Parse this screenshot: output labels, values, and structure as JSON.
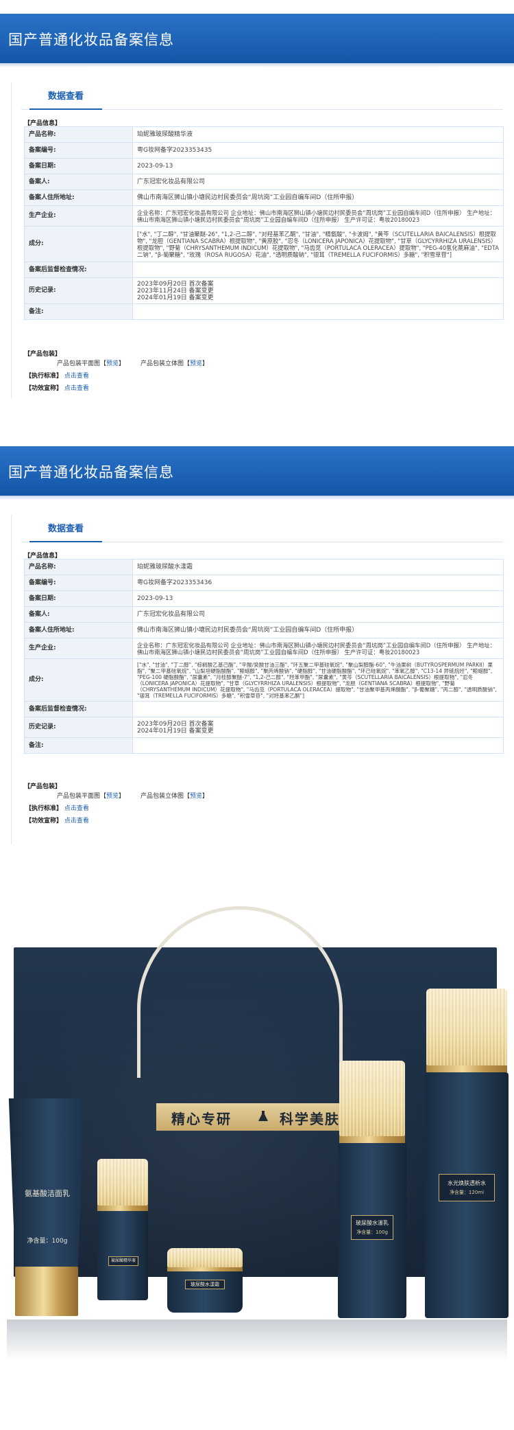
{
  "records": [
    {
      "header_title": "国产普通化妆品备案信息",
      "tab_label": "数据查看",
      "product_info_label": "【产品信息】",
      "fields": [
        {
          "key": "产品名称:",
          "value": "珀妮雅玻尿酸精华液"
        },
        {
          "key": "备案编号:",
          "value": "粤G妆网备字2023353435"
        },
        {
          "key": "备案日期:",
          "value": "2023-09-13"
        },
        {
          "key": "备案人:",
          "value": "广东冠宏化妆品有限公司"
        },
        {
          "key": "备案人住所地址:",
          "value": "佛山市南海区狮山镇小塘民边村民委员会“周坑岗”工业园自编车间D（住所申报）"
        },
        {
          "key": "生产企业:",
          "value": "企业名称：广东冠宏化妆品有限公司 企业地址：佛山市南海区狮山镇小塘民边村民委员会“周坑岗”工业园自编车间D（住所申报） 生产地址：佛山市南海区狮山镇小塘民边村民委员会“周坑岗”工业园自编车间D（住所申报） 生产许可证：粤妆20180023"
        },
        {
          "key": "成分:",
          "value": "[\"水\", \"丁二醇\", \"甘油聚醚-26\", \"1,2-己二醇\", \"对羟基苯乙酮\", \"甘油\", \"精氨酸\", \"卡波姆\", \"黄芩（SCUTELLARIA BAICALENSIS）根提取物\", \"龙胆（GENTIANA SCABRA）根提取物\", \"黄原胶\", \"忍冬（LONICERA JAPONICA）花提取物\", \"甘草（GLYCYRRHIZA URALENSIS）根提取物\", \"野菊（CHRYSANTHEMUM INDICUM）花提取物\", \"马齿苋（PORTULACA OLERACEA）提取物\", \"PEG-40氢化蓖麻油\", \"EDTA 二钠\", \"β-葡聚糖\", \"玫瑰（ROSA RUGOSA）花油\", \"透明质酸钠\", \"银耳（TREMELLA FUCIFORMIS）多糖\", \"积雪草苷\"]"
        },
        {
          "key": "备案后监督检查情况:",
          "value": ""
        },
        {
          "key": "历史记录:",
          "value_lines": [
            "2023年09月20日 首次备案",
            "2023年11月24日 备案变更",
            "2024年01月19日 备案变更"
          ]
        },
        {
          "key": "备注:",
          "value": ""
        }
      ],
      "packaging_label": "【产品包装】",
      "packaging_flat": "产品包装平面图",
      "packaging_3d": "产品包装立体图",
      "preview": "预览",
      "bracket_open": "【",
      "bracket_close": "】",
      "standard_label": "【执行标准】",
      "efficacy_label": "【功效宣称】",
      "click_view": "点击查看"
    },
    {
      "header_title": "国产普通化妆品备案信息",
      "tab_label": "数据查看",
      "product_info_label": "【产品信息】",
      "fields": [
        {
          "key": "产品名称:",
          "value": "珀妮雅玻尿酸水漾霜"
        },
        {
          "key": "备案编号:",
          "value": "粤G妆网备字2023353436"
        },
        {
          "key": "备案日期:",
          "value": "2023-09-13"
        },
        {
          "key": "备案人:",
          "value": "广东冠宏化妆品有限公司"
        },
        {
          "key": "备案人住所地址:",
          "value": "佛山市南海区狮山镇小塘民边村民委员会“周坑岗”工业园自编车间D（住所申报）"
        },
        {
          "key": "生产企业:",
          "value": "企业名称：广东冠宏化妆品有限公司 企业地址：佛山市南海区狮山镇小塘民边村民委员会“周坑岗”工业园自编车间D（住所申报） 生产地址：佛山市南海区狮山镇小塘民边村民委员会“周坑岗”工业园自编车间D（住所申报） 生产许可证：粤妆20180023"
        },
        {
          "key": "成分:",
          "value": "[\"水\", \"甘油\", \"丁二醇\", \"棕榈酸乙基己酯\", \"辛酸/癸酸甘油三酯\", \"环五聚二甲基硅氧烷\", \"聚山梨醇酯-60\", \"牛油果树（BUTYROSPERMUM PARKII）果脂\", \"聚二甲基硅氧烷\", \"山梨坦硬脂酸酯\", \"鲸蜡醇\", \"聚丙烯酸钠\", \"硬脂醇\", \"甘油硬脂酸酯\", \"环己硅氧烷\", \"苯氧乙醇\", \"C13-14 异链烷烃\", \"鲸蜡醇\", \"PEG-100 硬脂酸酯\", \"尿囊素\", \"月桂醇聚醚-7\", \"1,2-己二醇\", \"羟苯甲酯\", \"尿囊素\", \"黄芩（SCUTELLARIA BAICALENSIS）根提取物\", \"忍冬（LONICERA JAPONICA）花提取物\", \"甘草（GLYCYRRHIZA URALENSIS）根提取物\", \"龙胆（GENTIANA SCABRA）根提取物\", \"野菊（CHRYSANTHEMUM INDICUM）花提取物\", \"马齿苋（PORTULACA OLERACEA）提取物\", \"甘油聚甲基丙烯酸酯\", \"β-葡聚糖\", \"丙二醇\", \"透明质酸钠\", \"银耳（TREMELLA FUCIFORMIS）多糖\", \"积雪草苷\", \"对羟基苯乙酮\"]"
        },
        {
          "key": "备案后监督检查情况:",
          "value": ""
        },
        {
          "key": "历史记录:",
          "value_lines": [
            "2023年09月20日 首次备案",
            "2024年01月19日 备案变更"
          ]
        },
        {
          "key": "备注:",
          "value": ""
        }
      ],
      "packaging_label": "【产品包装】",
      "packaging_flat": "产品包装平面图",
      "packaging_3d": "产品包装立体图",
      "preview": "预览",
      "bracket_open": "【",
      "bracket_close": "】",
      "standard_label": "【执行标准】",
      "efficacy_label": "【功效宣称】",
      "click_view": "点击查看"
    }
  ],
  "product_photo": {
    "banner_left": "精心专研",
    "banner_right": "科学美肤",
    "tube_name": "氨基酸洁面乳",
    "tube_net": "净含量：100g",
    "serum_label": "玻尿酸精华液",
    "cream_label": "玻尿酸水漾霜",
    "emulsion_label": "玻尿酸水漾乳",
    "emulsion_net": "净含量：100g",
    "toner_label": "水光焕肤透析水",
    "toner_net": "净含量：120ml",
    "colors": {
      "box": "#1d2f44",
      "gold": "#c9ab6b",
      "bottle": "#243b55"
    }
  }
}
